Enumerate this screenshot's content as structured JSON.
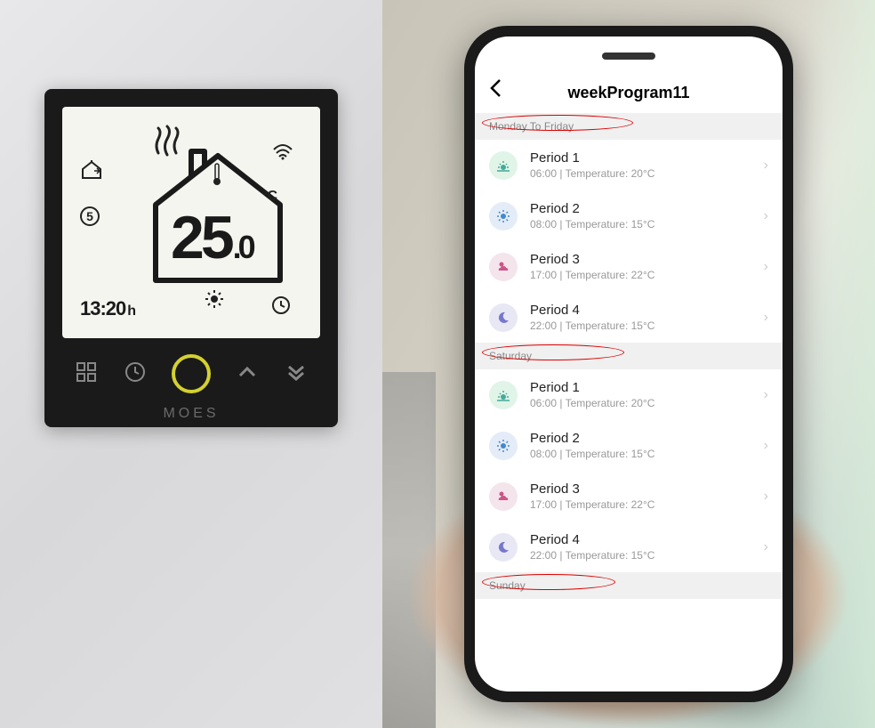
{
  "thermostat": {
    "temperature_int": "25",
    "temperature_dec": ".0",
    "unit": "°C",
    "time": "13:20",
    "time_unit": "h",
    "number_badge": "5",
    "brand": "MOES"
  },
  "phone": {
    "title": "weekProgram11",
    "sections": [
      {
        "label": "Monday To Friday",
        "oval_width": 170,
        "periods": [
          {
            "icon": "sunrise",
            "title": "Period 1",
            "time": "06:00",
            "temp": "20°C"
          },
          {
            "icon": "sun",
            "title": "Period 2",
            "time": "08:00",
            "temp": "15°C"
          },
          {
            "icon": "cloud",
            "title": "Period 3",
            "time": "17:00",
            "temp": "22°C"
          },
          {
            "icon": "moon",
            "title": "Period 4",
            "time": "22:00",
            "temp": "15°C"
          }
        ]
      },
      {
        "label": "Saturday",
        "oval_width": 160,
        "periods": [
          {
            "icon": "sunrise",
            "title": "Period 1",
            "time": "06:00",
            "temp": "20°C"
          },
          {
            "icon": "sun",
            "title": "Period 2",
            "time": "08:00",
            "temp": "15°C"
          },
          {
            "icon": "cloud",
            "title": "Period 3",
            "time": "17:00",
            "temp": "22°C"
          },
          {
            "icon": "moon",
            "title": "Period 4",
            "time": "22:00",
            "temp": "15°C"
          }
        ]
      },
      {
        "label": "Sunday",
        "oval_width": 150,
        "periods": []
      }
    ],
    "sub_template": "{time}  |  Temperature: {temp}"
  }
}
